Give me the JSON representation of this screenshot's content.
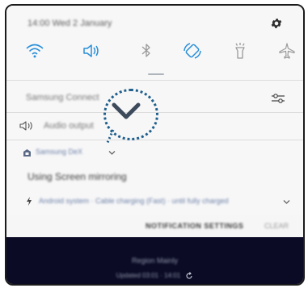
{
  "status": {
    "time_date": "14:00 Wed 2 January"
  },
  "quick_settings": [
    {
      "icon": "wifi-icon",
      "state": "on"
    },
    {
      "icon": "sound-icon",
      "state": "on"
    },
    {
      "icon": "bluetooth-icon",
      "state": "off"
    },
    {
      "icon": "auto-rotate-icon",
      "state": "on"
    },
    {
      "icon": "flashlight-icon",
      "state": "off"
    },
    {
      "icon": "airplane-mode-icon",
      "state": "off"
    }
  ],
  "samsung_connect": {
    "label": "Samsung Connect"
  },
  "audio_output": {
    "label": "Audio output"
  },
  "notification": {
    "app_name": "Samsung DeX",
    "title": "Using Screen mirroring",
    "system_line": "Android system · Cable charging (Fast) · until fully charged"
  },
  "actions": {
    "notification_settings": "NOTIFICATION SETTINGS",
    "clear": "CLEAR"
  },
  "lockscreen": {
    "network": "Region Mainly",
    "updated": "Updated 03:01 · 14:01"
  },
  "colors": {
    "accent": "#2a8fd8",
    "lower_bg": "#0b0b25",
    "bubble": "#1f5f8c"
  }
}
